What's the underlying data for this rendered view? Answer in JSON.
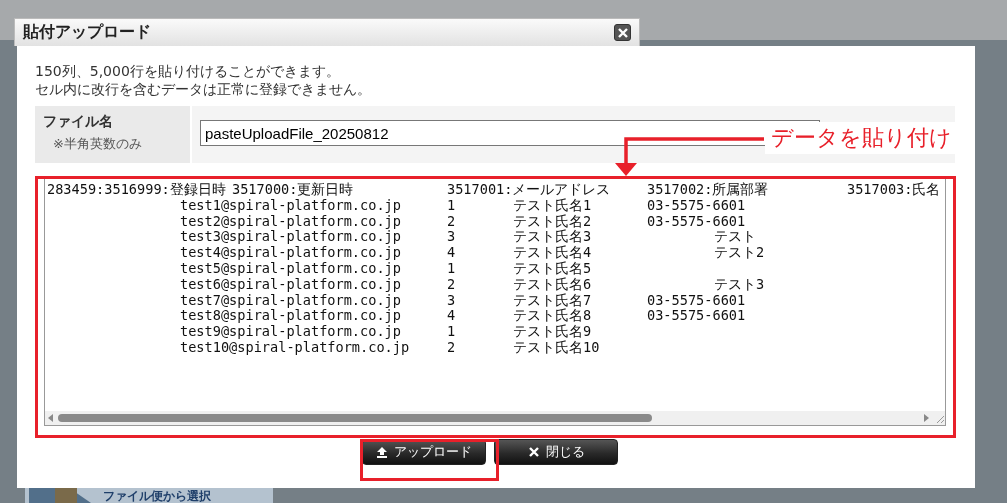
{
  "dialog": {
    "title": "貼付アップロード",
    "notes": [
      "150列、5,000行を貼り付けることができます。",
      "セル内に改行を含むデータは正常に登録できません。"
    ],
    "file_name": {
      "label": "ファイル名",
      "hint": "※半角英数のみ",
      "value": "pasteUploadFile_20250812"
    },
    "paste_area": {
      "header": [
        "283459:3516999:登録日時",
        "3517000:更新日時",
        "3517001:メールアドレス",
        "3517002:所属部署",
        "3517003:氏名"
      ],
      "rows": [
        {
          "email": "test1@spiral-platform.co.jp",
          "number": "1",
          "name": "テスト氏名1",
          "phone": "03-5575-6601"
        },
        {
          "email": "test2@spiral-platform.co.jp",
          "number": "2",
          "name": "テスト氏名2",
          "phone": "03-5575-6601"
        },
        {
          "email": "test3@spiral-platform.co.jp",
          "number": "3",
          "name": "テスト氏名3",
          "department": "テスト"
        },
        {
          "email": "test4@spiral-platform.co.jp",
          "number": "4",
          "name": "テスト氏名4",
          "department": "テスト2"
        },
        {
          "email": "test5@spiral-platform.co.jp",
          "number": "1",
          "name": "テスト氏名5"
        },
        {
          "email": "test6@spiral-platform.co.jp",
          "number": "2",
          "name": "テスト氏名6",
          "department": "テスト3"
        },
        {
          "email": "test7@spiral-platform.co.jp",
          "number": "3",
          "name": "テスト氏名7",
          "phone": "03-5575-6601"
        },
        {
          "email": "test8@spiral-platform.co.jp",
          "number": "4",
          "name": "テスト氏名8",
          "phone": "03-5575-6601"
        },
        {
          "email": "test9@spiral-platform.co.jp",
          "number": "1",
          "name": "テスト氏名9"
        },
        {
          "email": "test10@spiral-platform.co.jp",
          "number": "2",
          "name": "テスト氏名10"
        }
      ]
    },
    "buttons": [
      {
        "label": "アップロード",
        "kind": "upload"
      },
      {
        "label": "閉じる",
        "kind": "close"
      }
    ]
  },
  "annotation": {
    "label": "データを貼り付け"
  },
  "background": {
    "button_label": "ファイル便から選択"
  }
}
